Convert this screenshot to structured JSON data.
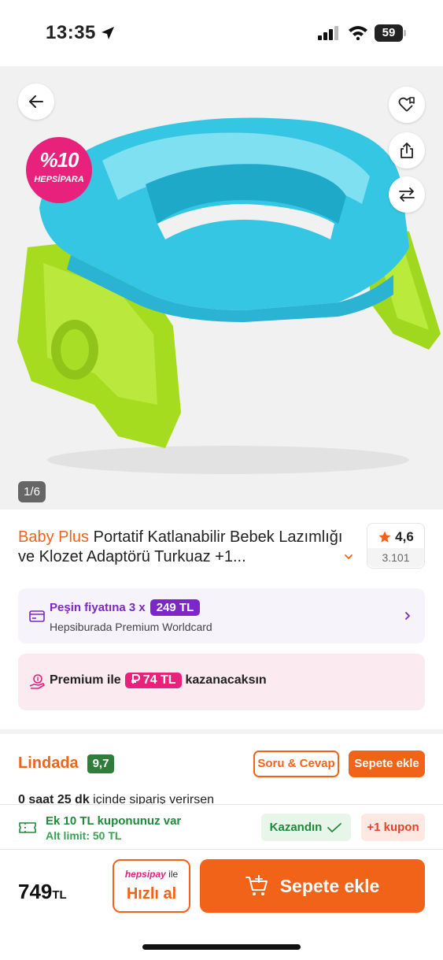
{
  "status_bar": {
    "time": "13:35",
    "battery": "59"
  },
  "gallery": {
    "counter": "1/6",
    "badge_percent": "%10",
    "badge_word": "HEPSİPARA"
  },
  "product": {
    "brand": "Baby Plus",
    "title": "Portatif Katlanabilir Bebek Lazımlığı ve Klozet Adaptörü Turkuaz +1...",
    "rating": "4,6",
    "review_count": "3.101"
  },
  "installment": {
    "prefix": "Peşin fiyatına 3 x",
    "amount": "249 TL",
    "card_name": "Hepsiburada Premium Worldcard"
  },
  "premium": {
    "prefix": "Premium ile",
    "amount": "74 TL",
    "suffix": "kazanacaksın"
  },
  "seller": {
    "name": "Lindada",
    "score": "9,7",
    "qa_label": "Soru & Cevap",
    "add_to_cart_label": "Sepete ekle",
    "delivery_bold": "0 saat 25 dk",
    "delivery_rest": " içinde sipariş verirsen"
  },
  "coupon": {
    "title": "Ek 10 TL kuponunuz var",
    "subtitle": "Alt limit: 50 TL",
    "won_label": "Kazandın",
    "coupon_label": "+1 kupon"
  },
  "bottom": {
    "price": "749",
    "currency": "TL",
    "hpay_brand": "hepsipay",
    "hpay_suffix": " ile",
    "hpay_label": "Hızlı al",
    "cart_label": "Sepete ekle"
  },
  "colors": {
    "brand_orange": "#f2631a",
    "premium_purple": "#7b27c9",
    "hepsipara_pink": "#e8227c",
    "success_green": "#1f8a3b"
  }
}
